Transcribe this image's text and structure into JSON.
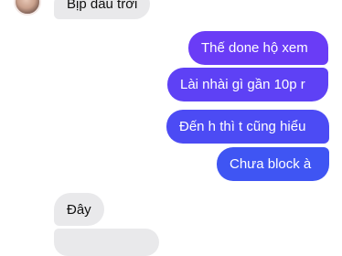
{
  "conversation": {
    "messages": [
      {
        "sender": "other",
        "text": "Bịp đâu trời"
      },
      {
        "sender": "me",
        "text": "Thế done hộ xem"
      },
      {
        "sender": "me",
        "text": "Lài nhài gì gần 10p r"
      },
      {
        "sender": "me",
        "text": "Đến h thì t cũng hiểu"
      },
      {
        "sender": "me",
        "text": "Chưa block à"
      },
      {
        "sender": "other",
        "text": "Đây"
      },
      {
        "sender": "other",
        "text": ""
      }
    ]
  },
  "colors": {
    "incoming_bubble": "#e9e9eb",
    "outgoing_gradient_top": "#6a3cf6",
    "outgoing_gradient_bottom": "#3f55f3"
  }
}
